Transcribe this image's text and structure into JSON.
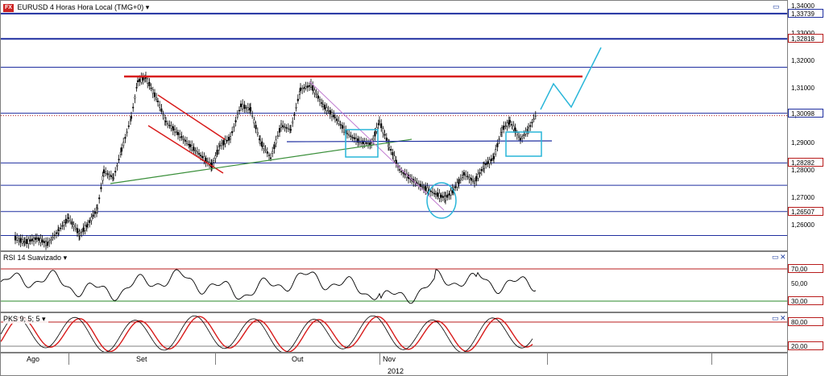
{
  "main_chart": {
    "title": "EURUSD 4 Horas Hora Local (TMG+0)",
    "symbol_badge": "FX",
    "price_ticks": [
      "1,34000",
      "1,33000",
      "1,32000",
      "1,31000",
      "1,30000",
      "1,29000",
      "1,28000",
      "1,27000",
      "1,26000"
    ],
    "price_tags": [
      {
        "label": "1,33739",
        "value": 1.33739,
        "color": "blue"
      },
      {
        "label": "1,32818",
        "value": 1.32818,
        "color": "red"
      },
      {
        "label": "1,30098",
        "value": 1.30098,
        "color": "blue"
      },
      {
        "label": "1,28282",
        "value": 1.28282,
        "color": "red"
      },
      {
        "label": "1,26507",
        "value": 1.26507,
        "color": "red"
      }
    ],
    "horizontal_levels": [
      1.33739,
      1.32818,
      1.3178,
      1.30098,
      1.28282,
      1.27468,
      1.26507,
      1.25634
    ],
    "resistance_level": 1.3144,
    "colors": {
      "levels": "#1f2fa0",
      "resistance": "#d81b1b",
      "candles": "#000000",
      "projection": "#29b6d9",
      "trendline_green": "#3a8f3a",
      "channel_red": "#d81b1b"
    }
  },
  "rsi_panel": {
    "title": "RSI 14 Suavizado",
    "levels": [
      {
        "label": "70,00",
        "value": 70,
        "color": "red"
      },
      {
        "label": "50,00",
        "value": 50,
        "color": "plain"
      },
      {
        "label": "30,00",
        "value": 30,
        "color": "red"
      }
    ]
  },
  "pks_panel": {
    "title": "PKS 9; 5; 5",
    "levels": [
      {
        "label": "80,00",
        "value": 80,
        "color": "red"
      },
      {
        "label": "20,00",
        "value": 20,
        "color": "plain"
      }
    ]
  },
  "time_axis": {
    "months": [
      "Ago",
      "Set",
      "Out",
      "Nov"
    ],
    "year": "2012"
  },
  "icons": {
    "maximize": "maximize-icon",
    "close": "close-icon",
    "dropdown": "dropdown-arrow-icon"
  }
}
